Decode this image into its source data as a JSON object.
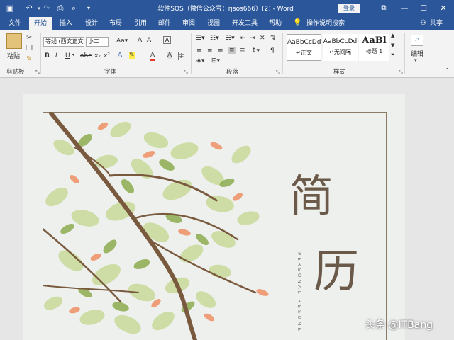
{
  "window": {
    "title": "软件SOS（微信公众号：rjsos666）(2) - Word",
    "login_label": "登录",
    "share_label": "共享"
  },
  "tabs": [
    "文件",
    "开始",
    "插入",
    "设计",
    "布局",
    "引用",
    "邮件",
    "审阅",
    "视图",
    "开发工具",
    "帮助"
  ],
  "tell_me": "操作说明搜索",
  "ribbon": {
    "clipboard": {
      "paste_label": "粘贴",
      "group_label": "剪贴板"
    },
    "font": {
      "font_name": "等线 (西文正文",
      "font_size": "小二",
      "group_label": "字体"
    },
    "paragraph": {
      "group_label": "段落"
    },
    "styles": {
      "group_label": "样式",
      "items": [
        {
          "preview": "AaBbCcDd",
          "name": "↵正文"
        },
        {
          "preview": "AaBbCcDd",
          "name": "↵无间隔"
        },
        {
          "preview": "AaBl",
          "name": "标题 1"
        }
      ]
    },
    "editing": {
      "label": "编辑"
    }
  },
  "document": {
    "title_chars": [
      "简",
      "历"
    ],
    "subtitle": "PERSONAL RESUME"
  },
  "watermark": "头条 @ITBang",
  "colors": {
    "accent": "#2b579a",
    "leaf_green": "#a9c55a",
    "leaf_orange": "#ee8a5a",
    "branch": "#7a5a3e"
  }
}
